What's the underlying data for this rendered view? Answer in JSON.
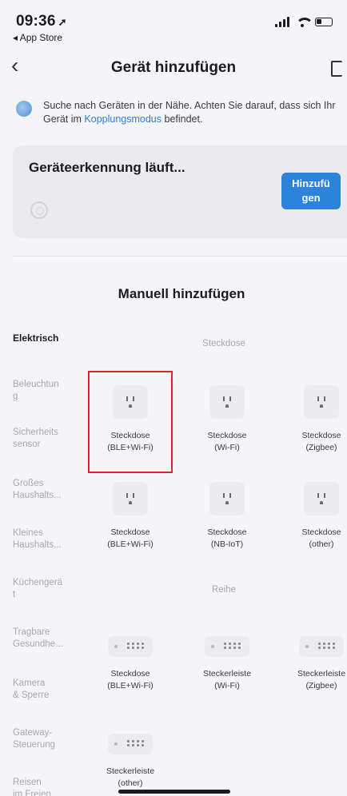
{
  "status_bar": {
    "time": "09:36",
    "location_glyph": "➚",
    "back_app": "◂ App Store"
  },
  "nav": {
    "back_glyph": "‹",
    "title": "Gerät hinzufügen"
  },
  "hint": {
    "text_before": "Suche nach Geräten in der Nähe. Achten Sie darauf, dass sich Ihr Gerät im ",
    "link": "Kopplungsmodus",
    "text_after": " befindet."
  },
  "discovery": {
    "label": "Geräteerkennung läuft...",
    "button_line1": "Hinzufü",
    "button_line2": "gen"
  },
  "manual": {
    "title": "Manuell hinzufügen"
  },
  "categories": [
    {
      "line1": "Elektrisch",
      "line2": ""
    },
    {
      "line1": "Beleuchtun",
      "line2": "g"
    },
    {
      "line1": "Sicherheits",
      "line2": "sensor"
    },
    {
      "line1": "Großes",
      "line2": "Haushalts..."
    },
    {
      "line1": "Kleines",
      "line2": "Haushalts..."
    },
    {
      "line1": "Küchengerä",
      "line2": "t"
    },
    {
      "line1": "Tragbare",
      "line2": "Gesundhe..."
    },
    {
      "line1": "Kamera",
      "line2": "& Sperre"
    },
    {
      "line1": "Gateway-",
      "line2": "Steuerung"
    },
    {
      "line1": "Reisen",
      "line2": "im Freien"
    }
  ],
  "sections": {
    "steckdose": "Steckdose",
    "reihe": "Reihe"
  },
  "items": [
    {
      "line1": "Steckdose",
      "line2": "(BLE+Wi-Fi)"
    },
    {
      "line1": "Steckdose",
      "line2": "(Wi-Fi)"
    },
    {
      "line1": "Steckdose",
      "line2": "(Zigbee)"
    },
    {
      "line1": "Steckdose",
      "line2": "(BLE+Wi-Fi)"
    },
    {
      "line1": "Steckdose",
      "line2": "(NB-IoT)"
    },
    {
      "line1": "Steckdose",
      "line2": "(other)"
    },
    {
      "line1": "Steckdose",
      "line2": "(BLE+Wi-Fi)"
    },
    {
      "line1": "Steckerleiste",
      "line2": "(Wi-Fi)"
    },
    {
      "line1": "Steckerleiste",
      "line2": "(Zigbee)"
    },
    {
      "line1": "Steckerleiste",
      "line2": "(other)"
    }
  ],
  "colors": {
    "accent": "#2d83d9",
    "highlight_border": "#d42a2a"
  },
  "icons": {
    "outlet": "outlet-icon",
    "power_strip": "power-strip-icon"
  }
}
